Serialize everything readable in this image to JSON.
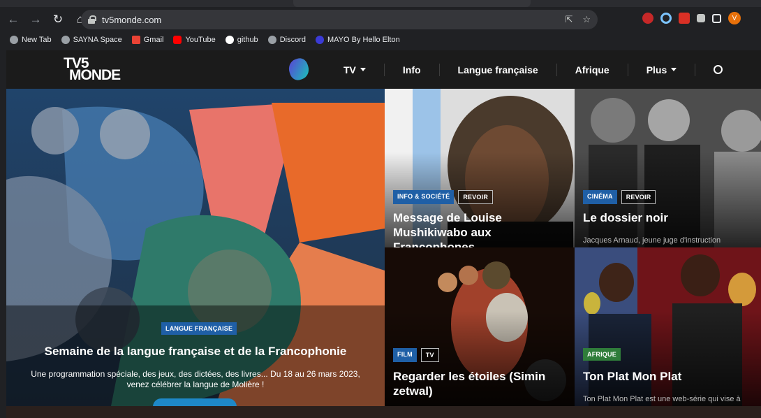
{
  "browser": {
    "url": "tv5monde.com",
    "bookmarks": [
      "New Tab",
      "SAYNA Space",
      "Gmail",
      "YouTube",
      "github",
      "Discord",
      "MAYO By Hello Elton"
    ],
    "avatar_letter": "V"
  },
  "site": {
    "logo_line1": "TV5",
    "logo_line2": "MONDE",
    "menu": [
      "TV",
      "Info",
      "Langue française",
      "Afrique",
      "Plus"
    ]
  },
  "hero": {
    "tag": "LANGUE FRANÇAISE",
    "title": "Semaine de la langue française et de la Francophonie",
    "description": "Une programmation spéciale, des jeux, des dictées, des livres... Du 18 au 26 mars 2023, venez célébrer la langue de Molière !"
  },
  "cards": [
    {
      "tags": [
        "INFO & SOCIÉTÉ",
        "REVOIR"
      ],
      "title": "Message de Louise Mushikiwabo aux Francophones",
      "subtitle": ""
    },
    {
      "tags": [
        "CINÉMA",
        "REVOIR"
      ],
      "title": "Le dossier noir",
      "subtitle": "Jacques Arnaud, jeune juge d'instruction"
    },
    {
      "tags": [
        "FILM",
        "TV"
      ],
      "title": "Regarder les étoiles (Simin zetwal)",
      "subtitle": ""
    },
    {
      "tags": [
        "AFRIQUE"
      ],
      "title": "Ton Plat Mon Plat",
      "subtitle": "Ton Plat Mon Plat est une web-série qui vise à"
    }
  ]
}
